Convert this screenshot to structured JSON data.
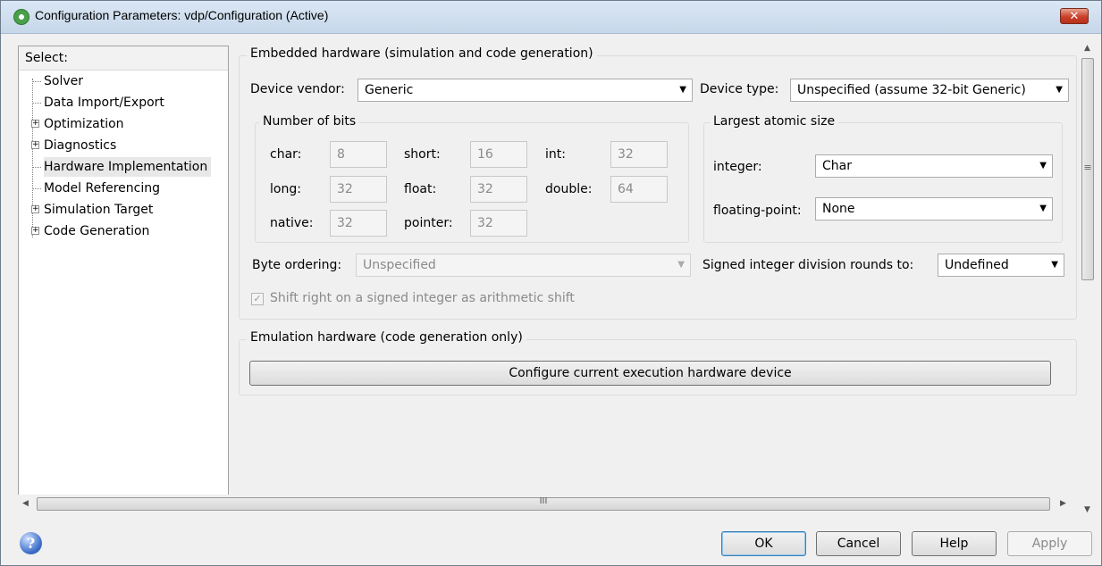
{
  "window": {
    "title": "Configuration Parameters: vdp/Configuration (Active)",
    "close_glyph": "✕"
  },
  "tree": {
    "header": "Select:",
    "items": [
      {
        "label": "Solver",
        "expandable": false
      },
      {
        "label": "Data Import/Export",
        "expandable": false
      },
      {
        "label": "Optimization",
        "expandable": true
      },
      {
        "label": "Diagnostics",
        "expandable": true
      },
      {
        "label": "Hardware Implementation",
        "expandable": false,
        "selected": true
      },
      {
        "label": "Model Referencing",
        "expandable": false
      },
      {
        "label": "Simulation Target",
        "expandable": true
      },
      {
        "label": "Code Generation",
        "expandable": true
      }
    ]
  },
  "embedded": {
    "title": "Embedded hardware (simulation and code generation)",
    "device_vendor_label": "Device vendor:",
    "device_vendor_value": "Generic",
    "device_type_label": "Device type:",
    "device_type_value": "Unspecified (assume 32-bit Generic)",
    "bits": {
      "title": "Number of bits",
      "char_label": "char:",
      "char_value": "8",
      "short_label": "short:",
      "short_value": "16",
      "int_label": "int:",
      "int_value": "32",
      "long_label": "long:",
      "long_value": "32",
      "float_label": "float:",
      "float_value": "32",
      "double_label": "double:",
      "double_value": "64",
      "native_label": "native:",
      "native_value": "32",
      "pointer_label": "pointer:",
      "pointer_value": "32"
    },
    "atomic": {
      "title": "Largest atomic size",
      "integer_label": "integer:",
      "integer_value": "Char",
      "floating_label": "floating-point:",
      "floating_value": "None"
    },
    "byte_ordering_label": "Byte ordering:",
    "byte_ordering_value": "Unspecified",
    "signed_division_label": "Signed integer division rounds to:",
    "signed_division_value": "Undefined",
    "shift_right_label": "Shift right on a signed integer as arithmetic shift",
    "shift_right_checked": true
  },
  "emulation": {
    "title": "Emulation hardware (code generation only)",
    "configure_button": "Configure current execution hardware device"
  },
  "buttons": {
    "ok": "OK",
    "cancel": "Cancel",
    "help": "Help",
    "apply": "Apply"
  },
  "scrollbar": {
    "h_grip": "III",
    "v_grip": "≡"
  },
  "icons": {
    "app": "configuration-gear-icon",
    "help": "help-question-icon"
  }
}
